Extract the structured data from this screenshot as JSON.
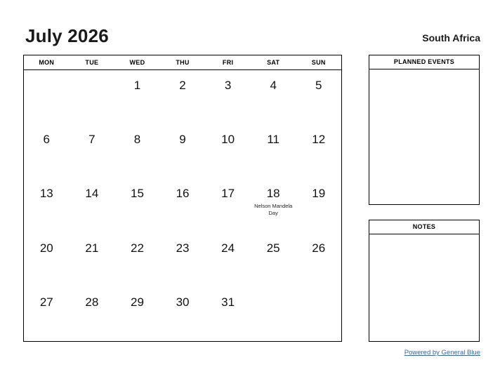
{
  "header": {
    "title": "July 2026",
    "region": "South Africa"
  },
  "calendar": {
    "weekdays": [
      "MON",
      "TUE",
      "WED",
      "THU",
      "FRI",
      "SAT",
      "SUN"
    ],
    "weeks": [
      [
        {
          "day": ""
        },
        {
          "day": ""
        },
        {
          "day": "1"
        },
        {
          "day": "2"
        },
        {
          "day": "3"
        },
        {
          "day": "4"
        },
        {
          "day": "5"
        }
      ],
      [
        {
          "day": "6"
        },
        {
          "day": "7"
        },
        {
          "day": "8"
        },
        {
          "day": "9"
        },
        {
          "day": "10"
        },
        {
          "day": "11"
        },
        {
          "day": "12"
        }
      ],
      [
        {
          "day": "13"
        },
        {
          "day": "14"
        },
        {
          "day": "15"
        },
        {
          "day": "16"
        },
        {
          "day": "17"
        },
        {
          "day": "18",
          "event": "Nelson Mandela Day"
        },
        {
          "day": "19"
        }
      ],
      [
        {
          "day": "20"
        },
        {
          "day": "21"
        },
        {
          "day": "22"
        },
        {
          "day": "23"
        },
        {
          "day": "24"
        },
        {
          "day": "25"
        },
        {
          "day": "26"
        }
      ],
      [
        {
          "day": "27"
        },
        {
          "day": "28"
        },
        {
          "day": "29"
        },
        {
          "day": "30"
        },
        {
          "day": "31"
        },
        {
          "day": ""
        },
        {
          "day": ""
        }
      ]
    ]
  },
  "panels": [
    {
      "id": "planned-events",
      "title": "PLANNED EVENTS",
      "content": ""
    },
    {
      "id": "notes",
      "title": "NOTES",
      "content": ""
    }
  ],
  "footer": {
    "link_label": "Powered by General Blue",
    "link_color": "#3a63ab"
  }
}
